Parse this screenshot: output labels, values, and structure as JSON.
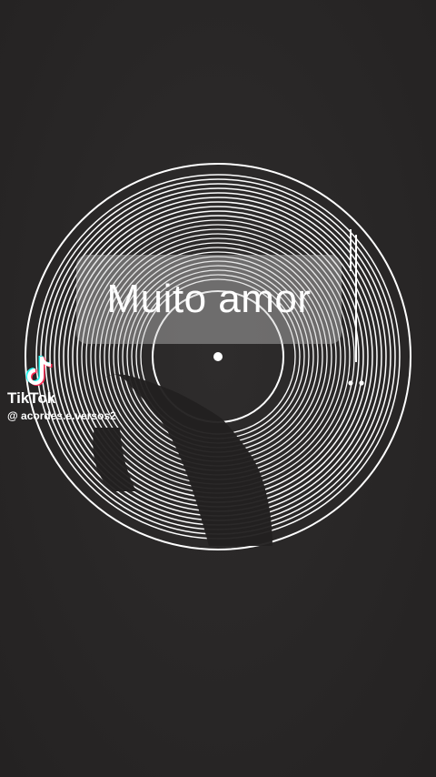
{
  "caption": {
    "text": "Muito amor"
  },
  "watermark": {
    "brand": "TikTok",
    "handle": "@ acordes.e.versos2",
    "logo_icon": "tiktok-logo-icon"
  },
  "artwork": {
    "icon": "vinyl-record-icon",
    "colors": {
      "background": "#2a2828",
      "lines": "#ffffff",
      "silhouette": "#1e1d1d"
    }
  }
}
